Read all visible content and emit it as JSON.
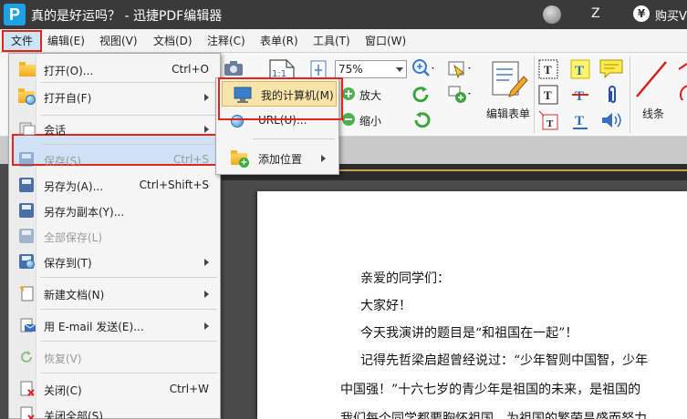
{
  "title_bar": {
    "app_logo_letter": "P",
    "title": "真的是好运吗？ - 迅捷PDF编辑器",
    "user_initial": "Z",
    "currency_symbol": "¥",
    "buy_label": "购买V"
  },
  "menubar": {
    "items": [
      "文件",
      "编辑(E)",
      "视图(V)",
      "文档(D)",
      "注释(C)",
      "表单(R)",
      "工具(T)",
      "窗口(W)"
    ]
  },
  "toolbar": {
    "zoom_value": "75%",
    "zoom_in_label": "放大",
    "zoom_out_label": "缩小",
    "edit_form_label": "编辑表单",
    "line_label": "线条",
    "page_fit_label": "1:1"
  },
  "file_menu": {
    "items": [
      {
        "label": "打开(O)...",
        "shortcut": "Ctrl+O"
      },
      {
        "label": "打开自(F)",
        "shortcut": ""
      },
      {
        "label": "会话",
        "shortcut": ""
      },
      {
        "label": "保存(S)",
        "shortcut": "Ctrl+S"
      },
      {
        "label": "另存为(A)...",
        "shortcut": "Ctrl+Shift+S"
      },
      {
        "label": "另存为副本(Y)...",
        "shortcut": ""
      },
      {
        "label": "全部保存(L)",
        "shortcut": ""
      },
      {
        "label": "保存到(T)",
        "shortcut": ""
      },
      {
        "label": "新建文档(N)",
        "shortcut": ""
      },
      {
        "label": "用 E-mail 发送(E)...",
        "shortcut": ""
      },
      {
        "label": "恢复(V)",
        "shortcut": ""
      },
      {
        "label": "关闭(C)",
        "shortcut": "Ctrl+W"
      },
      {
        "label": "关闭全部(S)",
        "shortcut": ""
      }
    ]
  },
  "open_from_submenu": {
    "items": [
      "我的计算机(M)",
      "URL(U)...",
      "添加位置"
    ]
  },
  "document": {
    "lines": [
      "亲爱的同学们：",
      "大家好！",
      "今天我演讲的题目是“和祖国在一起”！",
      "记得先哲梁启超曾经说过：“少年智则中国智，少年",
      "中国强！”十六七岁的青少年是祖国的未来，是祖国的",
      "我们每个同学都要胸怀祖国，为祖国的繁荣昌盛而努力"
    ]
  },
  "colors": {
    "title_bar": "#3a3a3a",
    "highlight_red": "#e0251b",
    "menu_hover": "#cfe2f6",
    "submenu_hover": "#f6e4a8"
  }
}
